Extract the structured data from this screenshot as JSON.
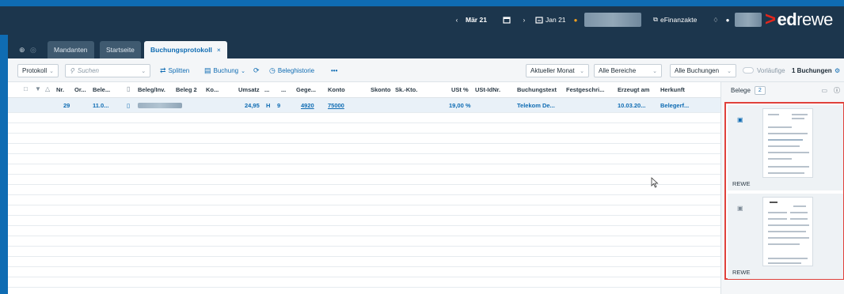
{
  "topbar": {
    "period_prev": "Mär 21",
    "period_next": "Jan 21",
    "efinanzakte": "eFinanzakte",
    "brand_chevron": ">",
    "brand_ed": "ed",
    "brand_rest": "rewe"
  },
  "tabs": [
    {
      "label": "Mandanten"
    },
    {
      "label": "Startseite"
    },
    {
      "label": "Buchungsprotokoll",
      "close": "×"
    }
  ],
  "toolbar": {
    "protokoll": "Protokoll",
    "search_placeholder": "Suchen",
    "splitten": "Splitten",
    "buchung": "Buchung",
    "beleghistorie": "Beleghistorie",
    "more": "•••",
    "filter_month": "Aktueller Monat",
    "filter_area": "Alle Bereiche",
    "filter_bookings": "Alle Buchungen",
    "vorlaeufige": "Vorläufige",
    "buchungen_count": "1 Buchungen"
  },
  "grid": {
    "columns": [
      "Nr.",
      "Or...",
      "Bele...",
      "Beleg/Inv.",
      "Beleg 2",
      "Ko...",
      "Umsatz",
      "...",
      "...",
      "Gege...",
      "Konto",
      "Skonto",
      "Sk.-Kto.",
      "USt %",
      "USt-IdNr.",
      "Buchungstext",
      "Festgeschri...",
      "Erzeugt am",
      "Herkunft"
    ],
    "row": {
      "nr": "29",
      "date": "11.0...",
      "umsatz": "24,95",
      "sh": "H",
      "bu": "9",
      "gegenkonto": "4920",
      "konto": "75000",
      "ust": "19,00 %",
      "buchungstext": "Telekom De...",
      "erzeugt": "10.03.20...",
      "herkunft": "Belegerf..."
    }
  },
  "side": {
    "title": "Belege",
    "count": "2",
    "cards": [
      {
        "label": "REWE"
      },
      {
        "label": "REWE"
      }
    ]
  },
  "colors": {
    "accent": "#0f6cb3",
    "header": "#1c364d",
    "highlight_border": "#e0413b"
  }
}
